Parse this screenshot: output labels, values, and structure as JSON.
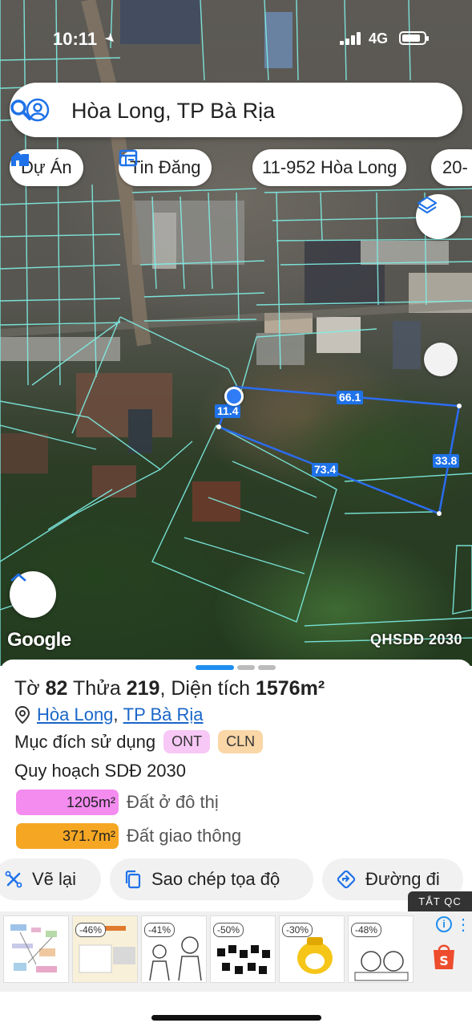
{
  "status_bar": {
    "time": "10:11",
    "network": "4G"
  },
  "search": {
    "query": "Hòa Long, TP Bà Rịa"
  },
  "chips": [
    {
      "label": "Dự Án",
      "icon": "house-icon"
    },
    {
      "label": "Tin Đăng",
      "icon": "listing-icon"
    },
    {
      "label": "11-952 Hòa Long"
    },
    {
      "label": "20-"
    }
  ],
  "map": {
    "parcel_label": "11.4",
    "dimensions": [
      "66.1",
      "33.8",
      "73.4"
    ],
    "attribution": "Google",
    "layer_tag": "QHSDĐ 2030"
  },
  "parcel": {
    "sheet_label": "Tờ",
    "sheet_no": "82",
    "lot_label": "Thửa",
    "lot_no": "219",
    "area_label": "Diện tích",
    "area": "1576m²",
    "ward": "Hòa Long",
    "city": "TP Bà Rịa",
    "purpose_label": "Mục đích sử dụng",
    "purposes": [
      {
        "code": "ONT",
        "color": "#f7c8f5"
      },
      {
        "code": "CLN",
        "color": "#fbd6a6"
      }
    ],
    "plan_title": "Quy hoạch SDĐ 2030",
    "plans": [
      {
        "area": "1205m²",
        "label": "Đất ở đô thị",
        "color": "#f48cf0"
      },
      {
        "area": "371.7m²",
        "label": "Đất giao thông",
        "color": "#f5a623"
      }
    ]
  },
  "actions": [
    {
      "label": "Vẽ lại",
      "icon": "redraw-icon"
    },
    {
      "label": "Sao chép tọa độ",
      "icon": "copy-icon"
    },
    {
      "label": "Đường đi",
      "icon": "directions-icon"
    }
  ],
  "ads": {
    "close_label": "TẮT QC",
    "items": [
      {
        "badge": ""
      },
      {
        "badge": "-46%"
      },
      {
        "badge": "-41%"
      },
      {
        "badge": "-50%"
      },
      {
        "badge": "-30%"
      },
      {
        "badge": "-48%"
      }
    ]
  },
  "colors": {
    "accent": "#1f72e8",
    "parcel_outline": "#2b6cf0",
    "cadastral_lines": "#7ff0e6"
  }
}
